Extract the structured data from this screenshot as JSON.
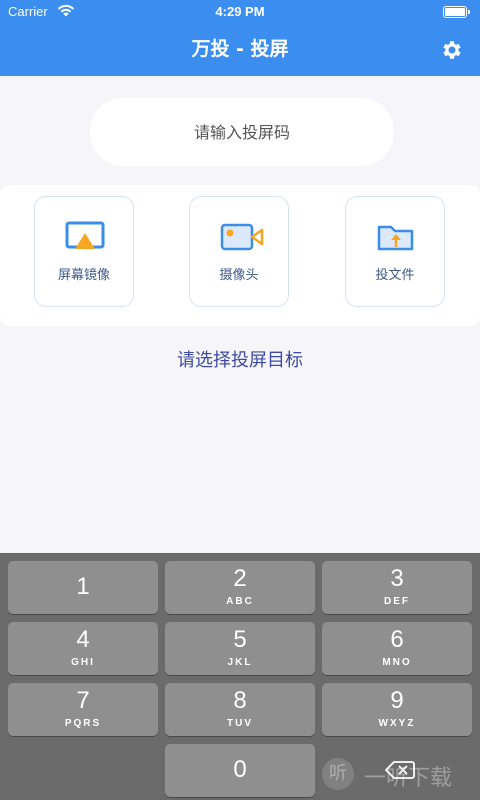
{
  "status_bar": {
    "carrier": "Carrier",
    "time": "4:29 PM",
    "wifi_icon": "wifi-icon",
    "battery_icon": "battery-icon"
  },
  "nav": {
    "title": "万投 - 投屏",
    "settings_icon": "gear-icon"
  },
  "code_input": {
    "placeholder": "请输入投屏码",
    "value": ""
  },
  "options": [
    {
      "label": "屏幕镜像",
      "icon": "screen-mirror-icon"
    },
    {
      "label": "摄像头",
      "icon": "camera-icon"
    },
    {
      "label": "投文件",
      "icon": "folder-upload-icon"
    }
  ],
  "prompt": "请选择投屏目标",
  "keypad": {
    "keys": [
      {
        "num": "1",
        "letters": ""
      },
      {
        "num": "2",
        "letters": "ABC"
      },
      {
        "num": "3",
        "letters": "DEF"
      },
      {
        "num": "4",
        "letters": "GHI"
      },
      {
        "num": "5",
        "letters": "JKL"
      },
      {
        "num": "6",
        "letters": "MNO"
      },
      {
        "num": "7",
        "letters": "PQRS"
      },
      {
        "num": "8",
        "letters": "TUV"
      },
      {
        "num": "9",
        "letters": "WXYZ"
      },
      {
        "num": "0",
        "letters": ""
      }
    ],
    "backspace_icon": "backspace-icon"
  },
  "watermark": {
    "icon_glyph": "听",
    "text": "一听下载"
  },
  "colors": {
    "primary": "#3b8ef0",
    "background": "#f6f6f8",
    "prompt_text": "#3d4aa0",
    "keypad_bg": "#6b6b6b",
    "key_bg": "#8f8f8f"
  }
}
